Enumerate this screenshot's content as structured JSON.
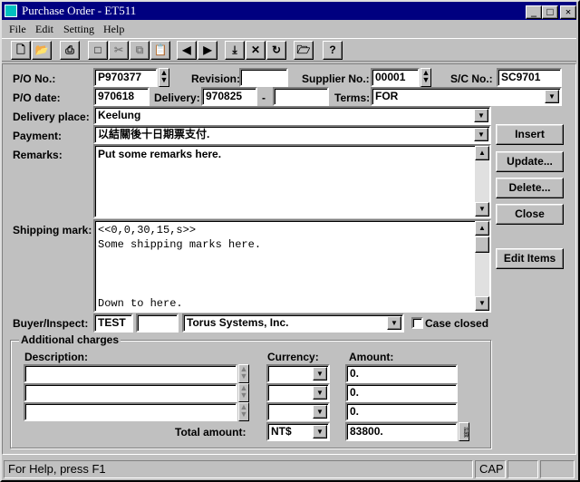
{
  "window": {
    "title": "Purchase Order - ET511"
  },
  "menu": [
    "File",
    "Edit",
    "Setting",
    "Help"
  ],
  "toolbar": {
    "buttons": [
      "new-icon",
      "open-icon",
      "print-icon",
      "blank-icon",
      "cut-icon",
      "copy-icon",
      "paste-icon",
      "prev-icon",
      "next-icon",
      "import-icon",
      "delete-icon",
      "refresh-icon",
      "folder-icon",
      "help-icon"
    ]
  },
  "form": {
    "po_no_label": "P/O No.:",
    "po_no": "P970377",
    "revision_label": "Revision:",
    "revision": "",
    "supplier_label": "Supplier No.:",
    "supplier": "00001",
    "sc_label": "S/C No.:",
    "sc": "SC9701",
    "po_date_label": "P/O date:",
    "po_date": "970618",
    "delivery_label": "Delivery:",
    "delivery_from": "970825",
    "delivery_dash": "-",
    "delivery_to": "",
    "terms_label": "Terms:",
    "terms": "FOR",
    "delivery_place_label": "Delivery place:",
    "delivery_place": "Keelung",
    "payment_label": "Payment:",
    "payment": "以結關後十日期票支付.",
    "remarks_label": "Remarks:",
    "remarks": "Put some remarks here.",
    "shipping_label": "Shipping mark:",
    "shipping_lines": [
      "<<0,0,30,15,s>>",
      "Some shipping marks here.",
      "",
      "",
      "",
      "Down to here."
    ],
    "buyer_label": "Buyer/Inspect:",
    "buyer": "TEST",
    "inspect": "",
    "company": "Torus Systems, Inc.",
    "case_closed_label": "Case closed",
    "case_closed": false
  },
  "actions": {
    "insert": "Insert",
    "update": "Update...",
    "delete": "Delete...",
    "close": "Close",
    "edit_items": "Edit Items"
  },
  "charges": {
    "group_label": "Additional charges",
    "description_header": "Description:",
    "currency_header": "Currency:",
    "amount_header": "Amount:",
    "rows": [
      {
        "description": "",
        "currency": "",
        "amount": "0."
      },
      {
        "description": "",
        "currency": "",
        "amount": "0."
      },
      {
        "description": "",
        "currency": "",
        "amount": "0."
      }
    ],
    "total_label": "Total amount:",
    "total_currency": "NT$",
    "total_amount": "83800.",
    "calc_label": "計算"
  },
  "status": {
    "help": "For Help, press F1",
    "cap": "CAP"
  }
}
